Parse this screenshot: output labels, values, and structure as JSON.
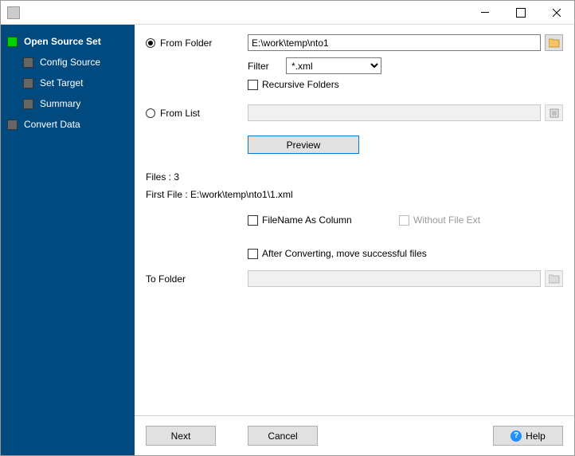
{
  "sidebar": {
    "items": [
      {
        "label": "Open Source Set"
      },
      {
        "label": "Config Source"
      },
      {
        "label": "Set Target"
      },
      {
        "label": "Summary"
      },
      {
        "label": "Convert Data"
      }
    ]
  },
  "form": {
    "from_folder_label": "From Folder",
    "from_folder_value": "E:\\work\\temp\\nto1",
    "filter_label": "Filter",
    "filter_value": "*.xml",
    "recursive_label": "Recursive Folders",
    "from_list_label": "From List",
    "from_list_value": "",
    "preview_label": "Preview",
    "files_count_label": "Files : 3",
    "first_file_label": "First File : E:\\work\\temp\\nto1\\1.xml",
    "filename_as_column_label": "FileName As Column",
    "without_ext_label": "Without File Ext",
    "after_convert_label": "After Converting, move successful files",
    "to_folder_label": "To Folder",
    "to_folder_value": ""
  },
  "footer": {
    "next": "Next",
    "cancel": "Cancel",
    "help": "Help"
  }
}
